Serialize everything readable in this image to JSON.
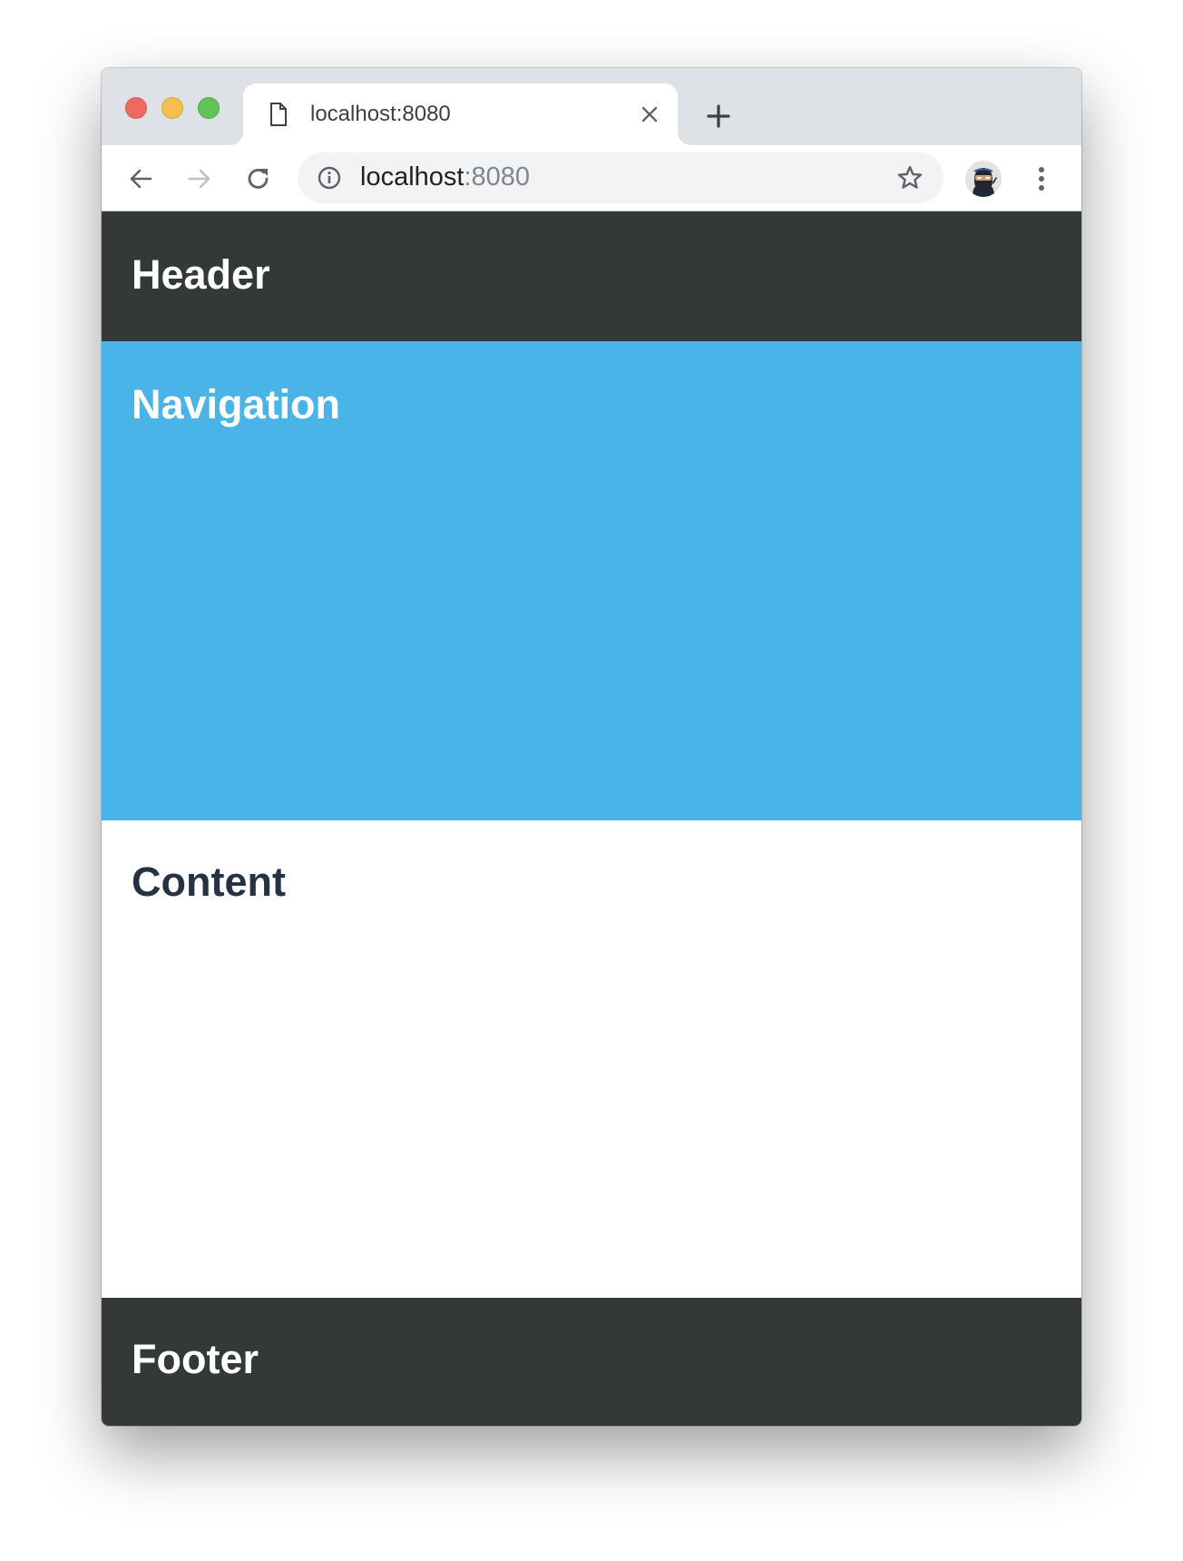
{
  "browser": {
    "tab": {
      "title": "localhost:8080",
      "icon": "document-icon",
      "close_icon": "close-icon"
    },
    "new_tab_icon": "plus-icon",
    "toolbar": {
      "back_icon": "arrow-left-icon",
      "forward_icon": "arrow-right-icon",
      "reload_icon": "reload-icon",
      "site_info_icon": "info-icon",
      "url_host": "localhost",
      "url_port": ":8080",
      "bookmark_icon": "star-icon",
      "profile_icon": "ninja-avatar",
      "menu_icon": "kebab-menu-icon"
    }
  },
  "page": {
    "header": {
      "title": "Header"
    },
    "navigation": {
      "title": "Navigation"
    },
    "content": {
      "title": "Content"
    },
    "footer": {
      "title": "Footer"
    }
  },
  "colors": {
    "header_bg": "#343839",
    "nav_bg": "#4ab3e8",
    "content_bg": "#ffffff",
    "content_text": "#263244",
    "footer_bg": "#343839"
  }
}
